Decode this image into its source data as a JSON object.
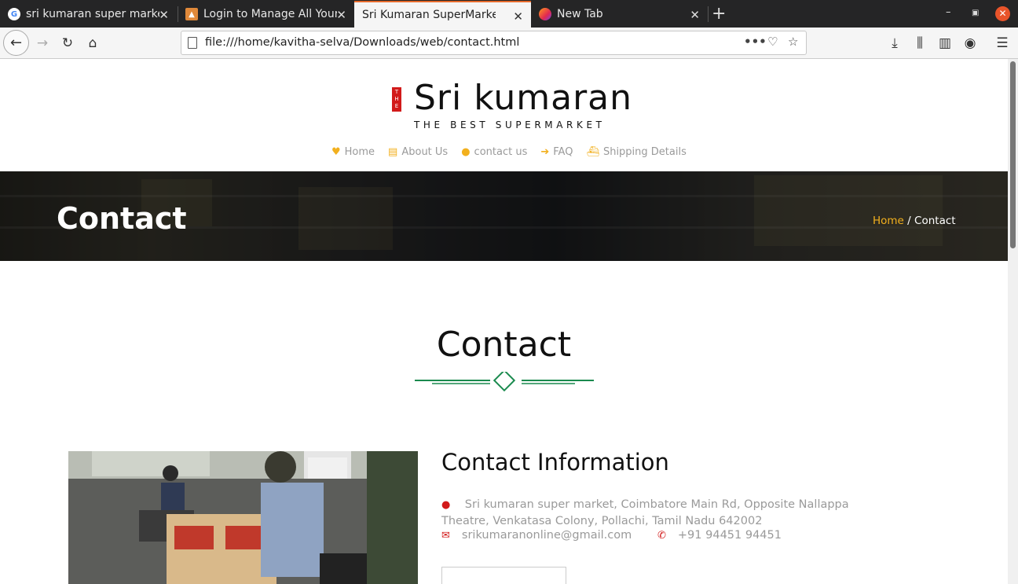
{
  "browser": {
    "tabs": [
      {
        "title": "sri kumaran super marke",
        "icon": "google-icon"
      },
      {
        "title": "Login to Manage All Your",
        "icon": "site-icon"
      },
      {
        "title": "Sri Kumaran SuperMarket - (",
        "icon": "none",
        "active": true
      },
      {
        "title": "New Tab",
        "icon": "firefox-icon"
      }
    ],
    "url": "file:///home/kavitha-selva/Downloads/web/contact.html"
  },
  "site": {
    "logo_mark": "THE",
    "brand": "Sri kumaran",
    "tagline": "THE BEST SUPERMARKET",
    "nav": [
      {
        "label": "Home",
        "icon": "heart-icon"
      },
      {
        "label": "About Us",
        "icon": "document-icon"
      },
      {
        "label": "contact us",
        "icon": "user-icon"
      },
      {
        "label": "FAQ",
        "icon": "arrow-right-icon"
      },
      {
        "label": "Shipping Details",
        "icon": "ship-icon"
      }
    ],
    "accent": "#f2b01e"
  },
  "banner": {
    "title": "Contact",
    "breadcrumb_home": "Home",
    "breadcrumb_sep": "/",
    "breadcrumb_current": "Contact"
  },
  "contact": {
    "heading": "Contact",
    "info_title": "Contact Information",
    "address": "Sri kumaran super market, Coimbatore Main Rd, Opposite Nallappa Theatre, Venkatasa Colony, Pollachi, Tamil Nadu 642002",
    "email": "srikumaranonline@gmail.com",
    "phone": "+91 94451 94451"
  }
}
